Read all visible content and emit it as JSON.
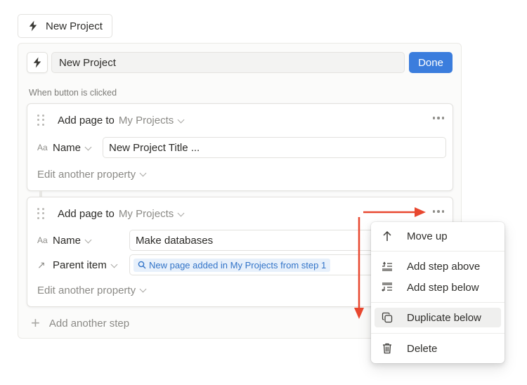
{
  "top_button": {
    "label": "New Project",
    "icon": "bolt-icon"
  },
  "editor": {
    "icon": "bolt-icon",
    "title_value": "New Project",
    "done_label": "Done",
    "trigger_label": "When button is clicked"
  },
  "steps": [
    {
      "verb": "Add page to",
      "target": "My Projects",
      "properties": [
        {
          "icon": "Aa",
          "name": "Name",
          "value": "New Project Title ..."
        }
      ],
      "edit_label": "Edit another property"
    },
    {
      "verb": "Add page to",
      "target": "My Projects",
      "properties": [
        {
          "icon": "Aa",
          "name": "Name",
          "value": "Make databases"
        },
        {
          "icon": "↗",
          "name": "Parent item",
          "value": "New page added in My Projects from step 1"
        }
      ],
      "edit_label": "Edit another property"
    }
  ],
  "add_step_label": "Add another step",
  "context_menu": {
    "items": [
      {
        "label": "Move up",
        "icon": "arrow-up-icon"
      },
      {
        "label": "Add step above",
        "icon": "insert-above-icon"
      },
      {
        "label": "Add step below",
        "icon": "insert-below-icon"
      },
      {
        "label": "Duplicate below",
        "icon": "duplicate-icon",
        "highlighted": true
      },
      {
        "label": "Delete",
        "icon": "trash-icon"
      }
    ]
  },
  "annotation_color": "#e8472f",
  "accent_color": "#3b7ddd"
}
